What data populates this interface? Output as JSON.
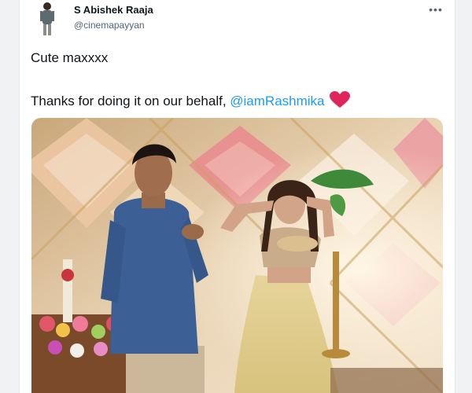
{
  "tweet": {
    "author": {
      "display_name": "S Abishek Raaja",
      "handle": "@cinemapayyan",
      "avatar_icon": "person-avatar"
    },
    "more_icon": "more-horizontal-icon",
    "more_label": "•••",
    "text": {
      "line1": "Cute maxxxx",
      "line2_prefix": "Thanks for doing it on our behalf, ",
      "mention": "@iamRashmika",
      "emoji": "red-heart-icon"
    },
    "media": {
      "kind": "photo",
      "scene": "man-and-woman-with-floral-backdrop"
    }
  },
  "colors": {
    "link": "#1d9bf0",
    "text": "#0f1419",
    "secondary": "#536471",
    "heart": "#e0245e"
  }
}
